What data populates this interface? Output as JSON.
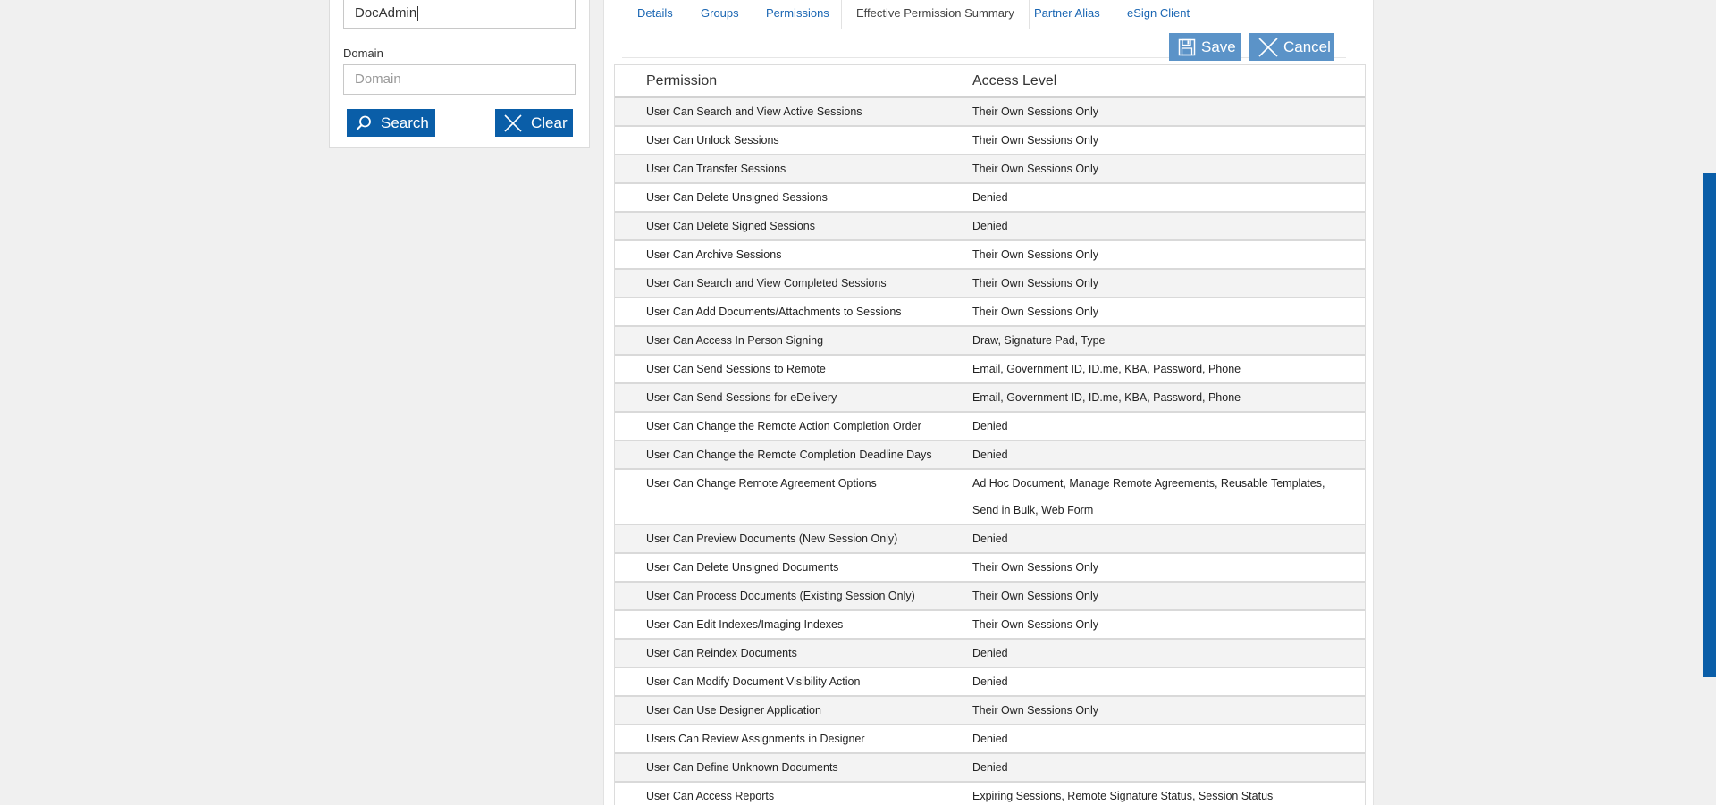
{
  "search": {
    "username_value": "DocAdmin",
    "domain_label": "Domain",
    "domain_placeholder": "Domain",
    "search_label": "Search",
    "clear_label": "Clear"
  },
  "tabs": {
    "details": "Details",
    "groups": "Groups",
    "permissions": "Permissions",
    "summary": "Effective Permission Summary",
    "partner_alias": "Partner Alias",
    "esign_client": "eSign Client"
  },
  "actions": {
    "save_label": "Save",
    "cancel_label": "Cancel"
  },
  "table": {
    "col_permission": "Permission",
    "col_access": "Access Level",
    "rows": [
      {
        "permission": "User Can Search and View Active Sessions",
        "access": "Their Own Sessions Only"
      },
      {
        "permission": "User Can Unlock Sessions",
        "access": "Their Own Sessions Only"
      },
      {
        "permission": "User Can Transfer Sessions",
        "access": "Their Own Sessions Only"
      },
      {
        "permission": "User Can Delete Unsigned Sessions",
        "access": "Denied"
      },
      {
        "permission": "User Can Delete Signed Sessions",
        "access": "Denied"
      },
      {
        "permission": "User Can Archive Sessions",
        "access": "Their Own Sessions Only"
      },
      {
        "permission": "User Can Search and View Completed Sessions",
        "access": "Their Own Sessions Only"
      },
      {
        "permission": "User Can Add Documents/Attachments to Sessions",
        "access": "Their Own Sessions Only"
      },
      {
        "permission": "User Can Access In Person Signing",
        "access": "Draw, Signature Pad, Type"
      },
      {
        "permission": "User Can Send Sessions to Remote",
        "access": "Email, Government ID, ID.me, KBA, Password, Phone"
      },
      {
        "permission": "User Can Send Sessions for eDelivery",
        "access": "Email, Government ID, ID.me, KBA, Password, Phone"
      },
      {
        "permission": "User Can Change the Remote Action Completion Order",
        "access": "Denied"
      },
      {
        "permission": "User Can Change the Remote Completion Deadline Days",
        "access": "Denied"
      },
      {
        "permission": "User Can Change Remote Agreement Options",
        "access": "Ad Hoc Document, Manage Remote Agreements, Reusable Templates, Send in Bulk, Web Form"
      },
      {
        "permission": "User Can Preview Documents (New Session Only)",
        "access": "Denied"
      },
      {
        "permission": "User Can Delete Unsigned Documents",
        "access": "Their Own Sessions Only"
      },
      {
        "permission": "User Can Process Documents (Existing Session Only)",
        "access": "Their Own Sessions Only"
      },
      {
        "permission": "User Can Edit Indexes/Imaging Indexes",
        "access": "Their Own Sessions Only"
      },
      {
        "permission": "User Can Reindex Documents",
        "access": "Denied"
      },
      {
        "permission": "User Can Modify Document Visibility Action",
        "access": "Denied"
      },
      {
        "permission": "User Can Use Designer Application",
        "access": "Their Own Sessions Only"
      },
      {
        "permission": "Users Can Review Assignments in Designer",
        "access": "Denied"
      },
      {
        "permission": "User Can Define Unknown Documents",
        "access": "Denied"
      },
      {
        "permission": "User Can Access Reports",
        "access": "Expiring Sessions, Remote Signature Status, Session Status"
      }
    ]
  },
  "colors": {
    "primary_button": "#0a5ea8",
    "secondary_button": "#5b93c8",
    "link": "#1a66b3"
  }
}
